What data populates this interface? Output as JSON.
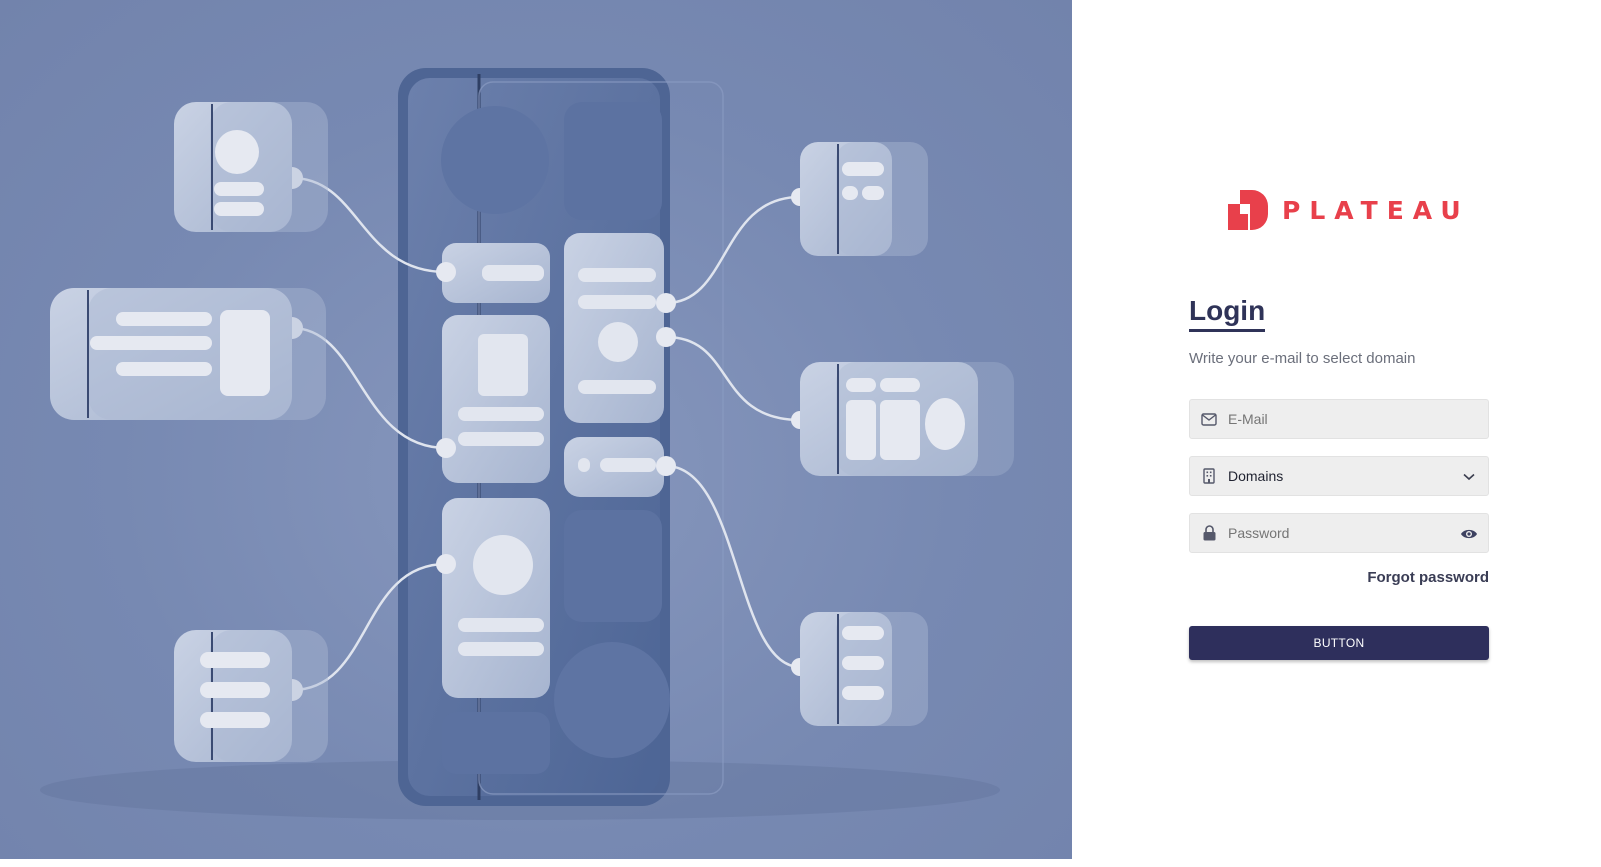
{
  "brand": {
    "name": "PLATEAU",
    "accent": "#e8404b"
  },
  "login": {
    "title": "Login",
    "subtitle": "Write your e-mail to select domain",
    "email": {
      "placeholder": "E-Mail",
      "icon": "envelope-icon"
    },
    "domain": {
      "value": "Domains",
      "icon": "building-icon",
      "toggle_icon": "chevron-down-icon"
    },
    "password": {
      "placeholder": "Password",
      "icon": "lock-icon",
      "toggle_icon": "eye-icon"
    },
    "forgot_label": "Forgot password",
    "submit_label": "BUTTON"
  },
  "colors": {
    "primary": "#2e2f5c",
    "heading": "#2f3358",
    "illustration_bg": "#7789b2"
  }
}
